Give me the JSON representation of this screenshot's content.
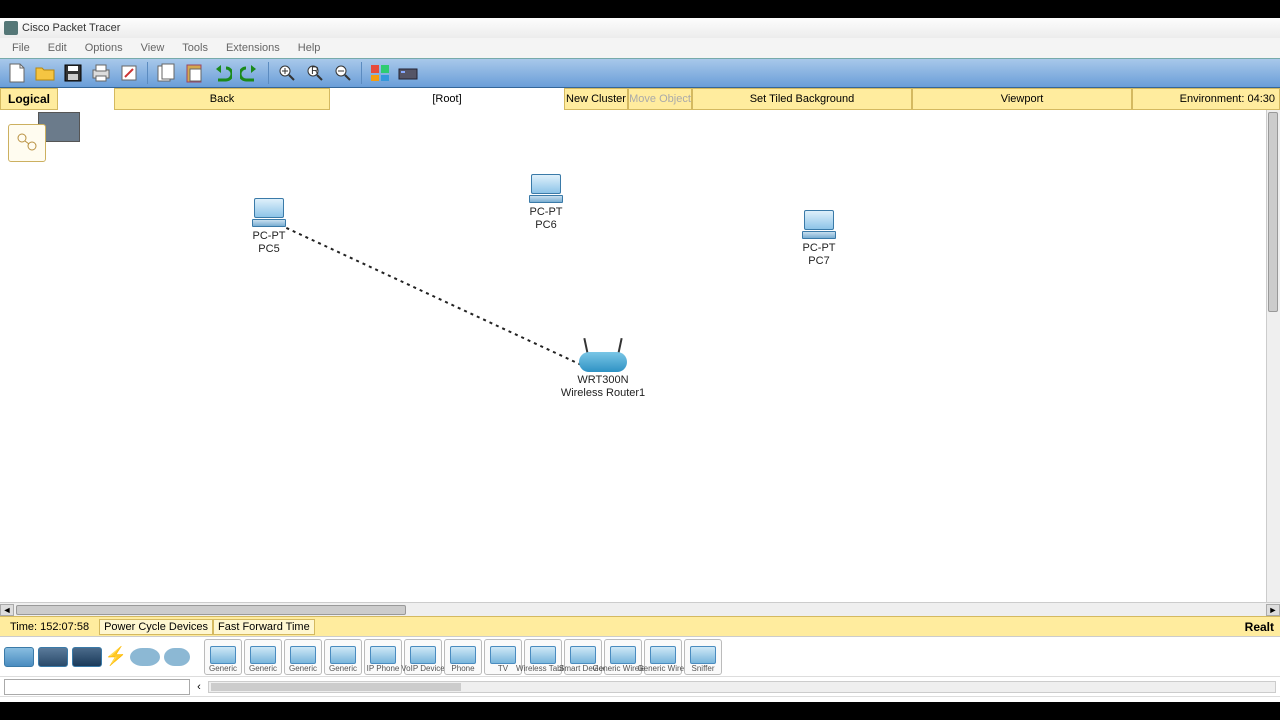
{
  "app": {
    "title": "Cisco Packet Tracer"
  },
  "menu": {
    "file": "File",
    "edit": "Edit",
    "options": "Options",
    "view": "View",
    "tools": "Tools",
    "extensions": "Extensions",
    "help": "Help"
  },
  "secondbar": {
    "logical": "Logical",
    "back": "Back",
    "root": "[Root]",
    "new_cluster": "New Cluster",
    "move_object": "Move Object",
    "tiled_bg": "Set Tiled Background",
    "viewport": "Viewport",
    "environment": "Environment: 04:30"
  },
  "devices": {
    "pc5": {
      "type": "PC-PT",
      "name": "PC5"
    },
    "pc6": {
      "type": "PC-PT",
      "name": "PC6"
    },
    "pc7": {
      "type": "PC-PT",
      "name": "PC7"
    },
    "router": {
      "model": "WRT300N",
      "name": "Wireless Router1"
    }
  },
  "timebar": {
    "time_label": "Time: 152:07:58",
    "power_cycle": "Power Cycle Devices",
    "fast_forward": "Fast Forward Time",
    "realtime": "Realt"
  },
  "palette": {
    "items": [
      "Generic",
      "Generic",
      "Generic",
      "Generic",
      "IP Phone",
      "VoIP Device",
      "Phone",
      "TV",
      "Wireless Tablet",
      "Smart Device",
      "Generic Wireless",
      "Generic Wired",
      "Sniffer"
    ]
  },
  "filter": {
    "placeholder": ""
  }
}
